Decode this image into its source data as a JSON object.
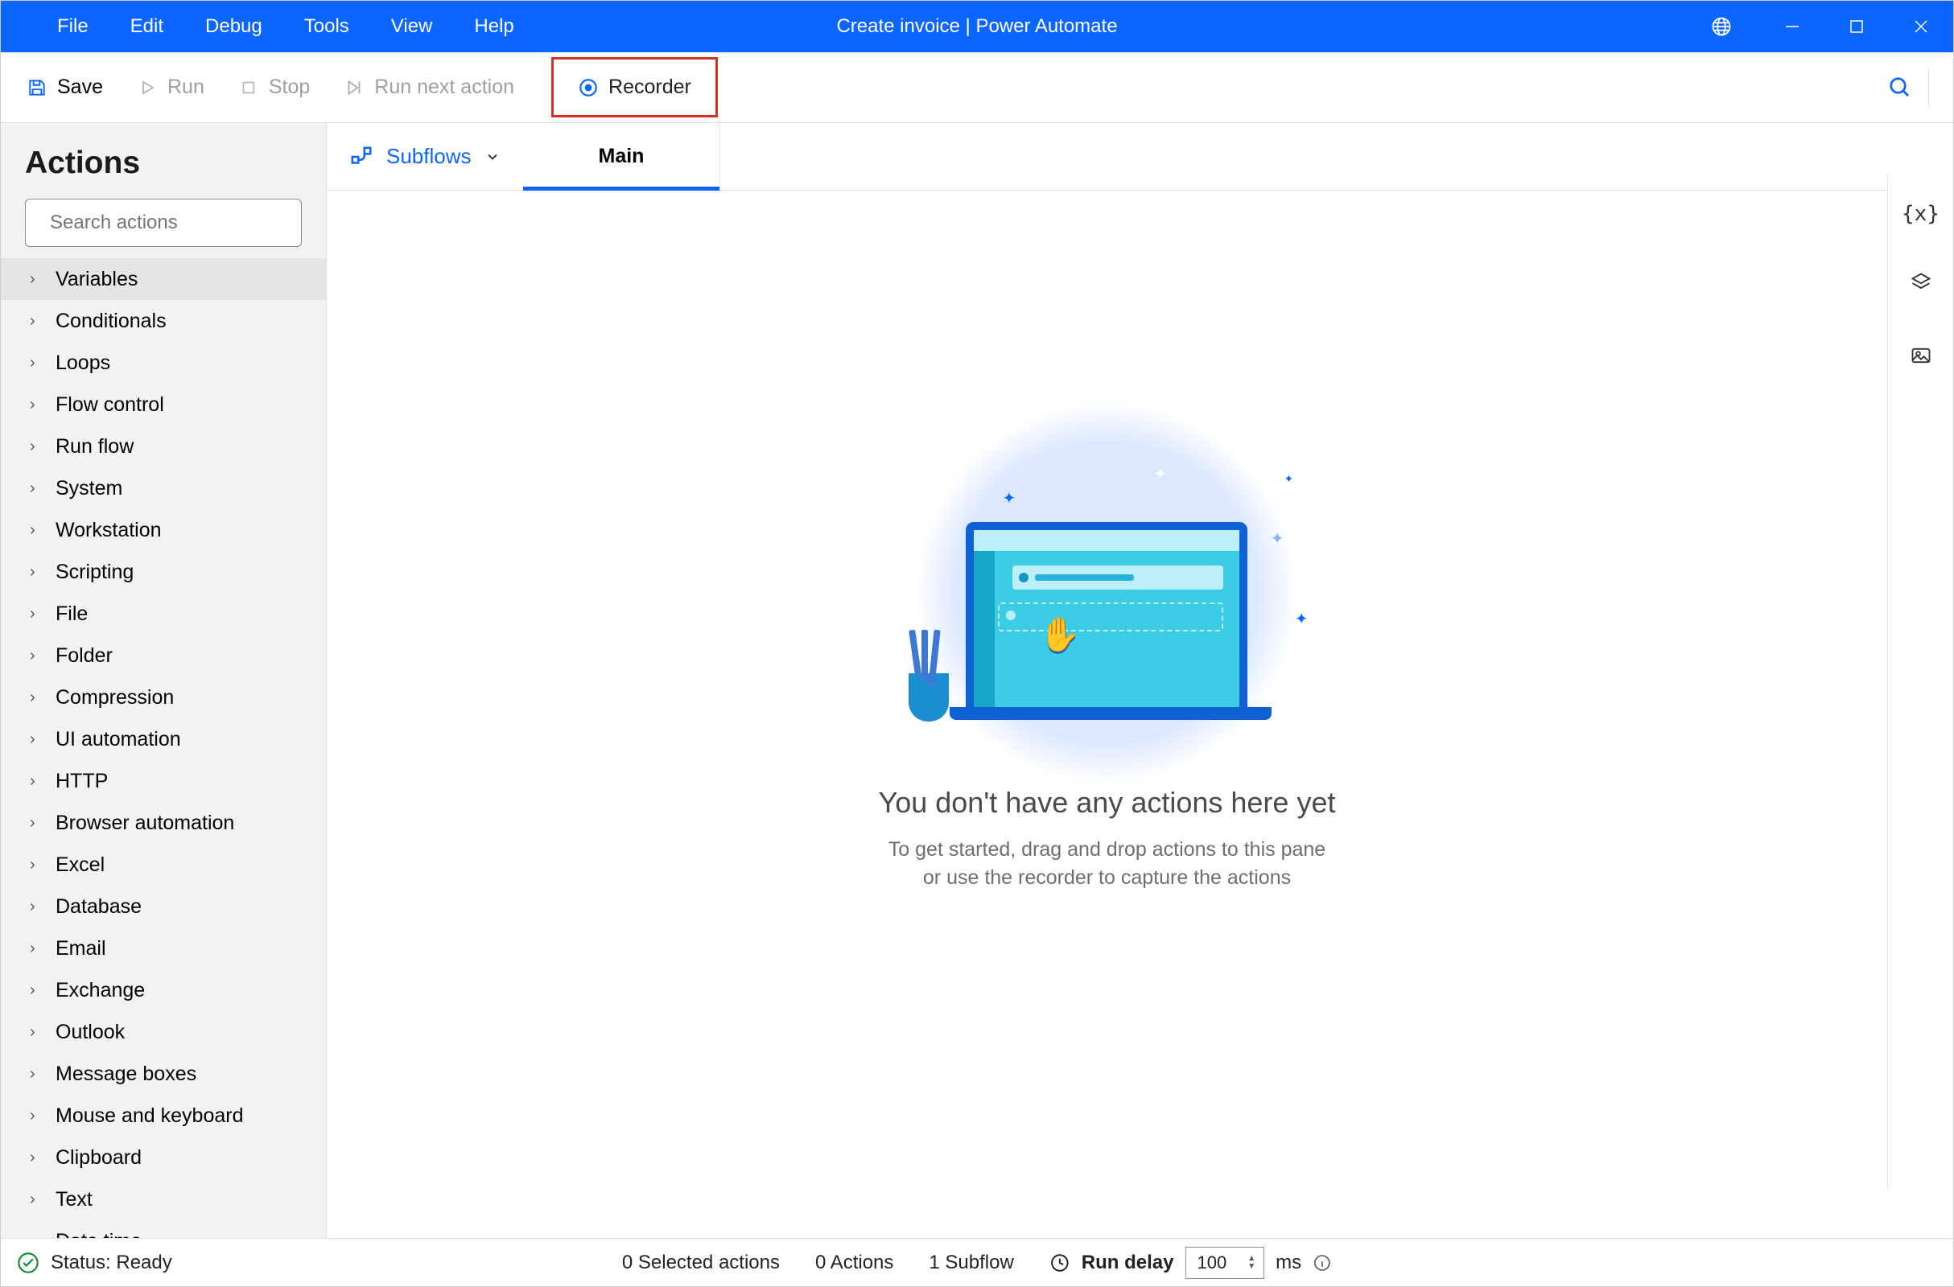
{
  "menu": [
    "File",
    "Edit",
    "Debug",
    "Tools",
    "View",
    "Help"
  ],
  "title": "Create invoice | Power Automate",
  "account_placeholder": "",
  "toolbar": {
    "save": "Save",
    "run": "Run",
    "stop": "Stop",
    "run_next": "Run next action",
    "recorder": "Recorder"
  },
  "sidebar": {
    "title": "Actions",
    "search_placeholder": "Search actions",
    "items": [
      "Variables",
      "Conditionals",
      "Loops",
      "Flow control",
      "Run flow",
      "System",
      "Workstation",
      "Scripting",
      "File",
      "Folder",
      "Compression",
      "UI automation",
      "HTTP",
      "Browser automation",
      "Excel",
      "Database",
      "Email",
      "Exchange",
      "Outlook",
      "Message boxes",
      "Mouse and keyboard",
      "Clipboard",
      "Text",
      "Date time"
    ],
    "selected_index": 0
  },
  "subtabs": {
    "subflows_label": "Subflows",
    "tabs": [
      "Main"
    ],
    "active_index": 0
  },
  "empty": {
    "heading": "You don't have any actions here yet",
    "line1": "To get started, drag and drop actions to this pane",
    "line2": "or use the recorder to capture the actions"
  },
  "status": {
    "ready": "Status: Ready",
    "selected": "0 Selected actions",
    "actions": "0 Actions",
    "subflows": "1 Subflow",
    "delay_label": "Run delay",
    "delay_value": "100",
    "delay_unit": "ms"
  },
  "right_rail": {
    "variables_icon": "{x}",
    "layers_icon": "layers",
    "image_icon": "image"
  }
}
